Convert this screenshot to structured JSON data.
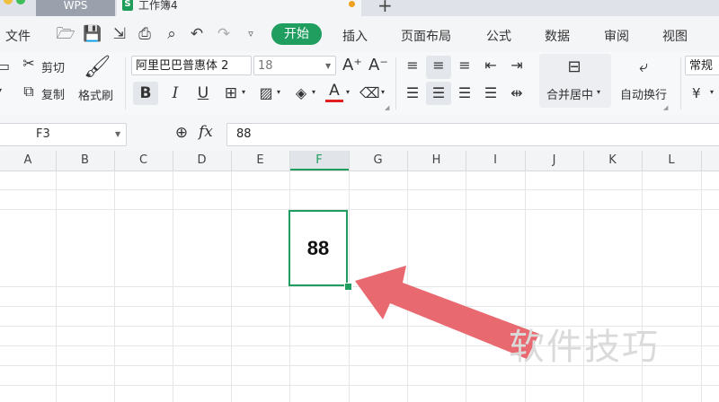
{
  "tabs": {
    "app_label": "WPS",
    "doc_icon": "S",
    "doc_title": "工作簿4",
    "new_tab": "+"
  },
  "menu": {
    "file": "文件",
    "start": "开始",
    "insert": "插入",
    "layout": "页面布局",
    "formula": "公式",
    "data": "数据",
    "review": "审阅",
    "view": "视图"
  },
  "ribbon": {
    "cut": "剪切",
    "copy": "复制",
    "format_painter": "格式刷",
    "font_name": "阿里巴巴普惠体 2",
    "font_size": "18",
    "merge_center": "合并居中",
    "wrap_text": "自动换行",
    "number_format": "常规",
    "currency_symbol": "¥"
  },
  "formula_bar": {
    "name_box": "F3",
    "fx": "fx",
    "content": "88"
  },
  "grid": {
    "columns": [
      "A",
      "B",
      "C",
      "D",
      "E",
      "F",
      "G",
      "H",
      "I",
      "J",
      "K",
      "L"
    ],
    "selected_column": "F",
    "selected_cell": "F3",
    "cell_value": "88"
  },
  "watermark": "软件技巧",
  "colors": {
    "accent": "#1f9e5f",
    "annotation_arrow": "#e86a70"
  }
}
